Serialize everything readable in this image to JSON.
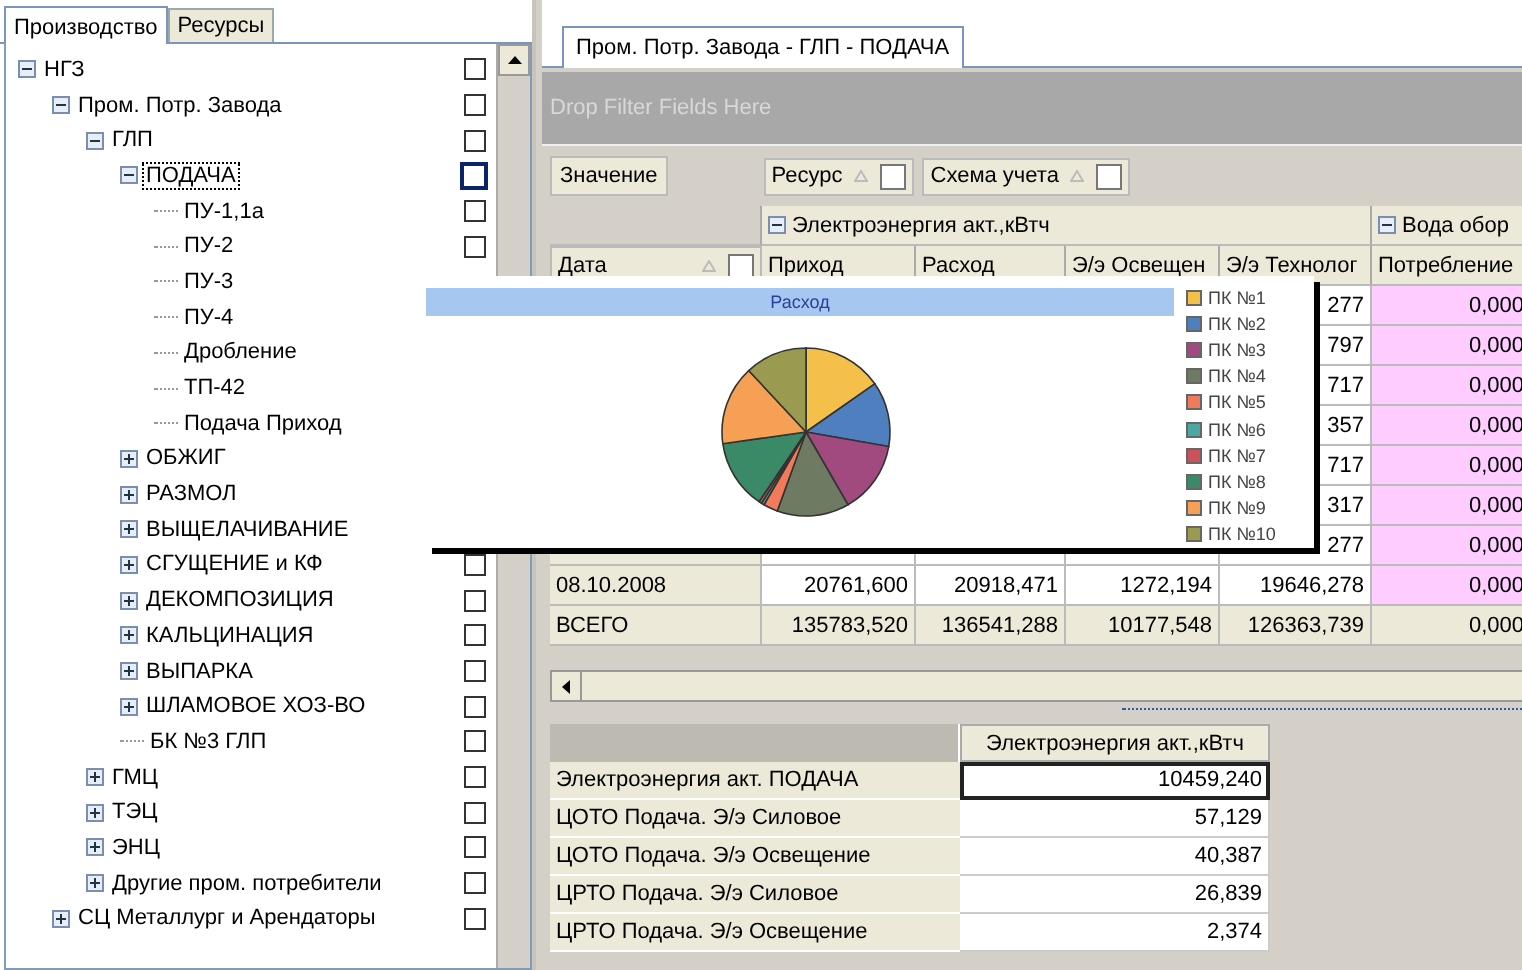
{
  "left_tabs": [
    {
      "label": "Производство",
      "selected": true
    },
    {
      "label": "Ресурсы",
      "selected": false
    }
  ],
  "tree": [
    {
      "label": "НГЗ",
      "expanded": true,
      "checked": false,
      "selected": false,
      "children": [
        {
          "label": "Пром. Потр. Завода",
          "expanded": true,
          "checked": false,
          "selected": false,
          "children": [
            {
              "label": "ГЛП",
              "expanded": true,
              "checked": false,
              "selected": false,
              "children": [
                {
                  "label": "ПОДАЧА",
                  "expanded": true,
                  "checked": false,
                  "selected": true,
                  "children": [
                    {
                      "label": "ПУ-1,1а",
                      "checked": false,
                      "selected": false
                    },
                    {
                      "label": "ПУ-2",
                      "checked": false,
                      "selected": false
                    },
                    {
                      "label": "ПУ-3",
                      "selected": false
                    },
                    {
                      "label": "ПУ-4",
                      "selected": false
                    },
                    {
                      "label": "Дробление",
                      "selected": false
                    },
                    {
                      "label": "ТП-42",
                      "selected": false
                    },
                    {
                      "label": "Подача Приход",
                      "selected": false
                    }
                  ]
                },
                {
                  "label": "ОБЖИГ",
                  "expanded": false,
                  "selected": false
                },
                {
                  "label": "РАЗМОЛ",
                  "expanded": false,
                  "selected": false
                },
                {
                  "label": "ВЫЩЕЛАЧИВАНИЕ",
                  "expanded": false,
                  "selected": false
                },
                {
                  "label": "СГУЩЕНИЕ и КФ",
                  "expanded": false,
                  "checked": false,
                  "selected": false
                },
                {
                  "label": "ДЕКОМПОЗИЦИЯ",
                  "expanded": false,
                  "checked": false,
                  "selected": false
                },
                {
                  "label": "КАЛЬЦИНАЦИЯ",
                  "expanded": false,
                  "checked": false,
                  "selected": false
                },
                {
                  "label": "ВЫПАРКА",
                  "expanded": false,
                  "checked": false,
                  "selected": false
                },
                {
                  "label": "ШЛАМОВОЕ ХОЗ-ВО",
                  "expanded": false,
                  "checked": false,
                  "selected": false
                },
                {
                  "label": "БК №3 ГЛП",
                  "checked": false,
                  "selected": false
                }
              ]
            },
            {
              "label": "ГМЦ",
              "expanded": false,
              "checked": false,
              "selected": false
            },
            {
              "label": "ТЭЦ",
              "expanded": false,
              "checked": false,
              "selected": false
            },
            {
              "label": "ЭНЦ",
              "expanded": false,
              "checked": false,
              "selected": false
            },
            {
              "label": "Другие пром. потребители",
              "expanded": false,
              "checked": false,
              "selected": false
            }
          ]
        },
        {
          "label": "СЦ Металлург и Арендаторы",
          "expanded": false,
          "checked": false,
          "selected": false
        }
      ]
    }
  ],
  "document_tab": {
    "label": "Пром. Потр. Завода - ГЛП - ПОДАЧА",
    "selected": true
  },
  "filter_area": {
    "placeholder": "Drop Filter Fields Here"
  },
  "data_field": "Значение",
  "column_fields": [
    {
      "label": "Ресурс"
    },
    {
      "label": "Схема учета"
    }
  ],
  "row_field": "Дата",
  "column_groups": [
    {
      "label": "Электроэнергия акт.,кВтч",
      "expanded": true,
      "columns": [
        "Приход",
        "Расход",
        "Э/э Освещен",
        "Э/э Технолог"
      ]
    },
    {
      "label": "Вода обор",
      "expanded": true,
      "columns": [
        "Потребление"
      ]
    }
  ],
  "rows": [
    {
      "kind": "partial",
      "cells": [
        "277",
        "0,000"
      ]
    },
    {
      "kind": "partial",
      "cells": [
        "797",
        "0,000"
      ]
    },
    {
      "kind": "partial",
      "cells": [
        "717",
        "0,000"
      ]
    },
    {
      "kind": "partial",
      "cells": [
        "357",
        "0,000"
      ]
    },
    {
      "kind": "partial",
      "cells": [
        "717",
        "0,000"
      ]
    },
    {
      "kind": "partial",
      "cells": [
        "317",
        "0,000"
      ]
    },
    {
      "kind": "partial",
      "cells": [
        "277",
        "0,000"
      ]
    },
    {
      "kind": "data",
      "cells": [
        "08.10.2008",
        "20761,600",
        "20918,471",
        "1272,194",
        "19646,278",
        "0,000"
      ]
    },
    {
      "kind": "total",
      "cells": [
        "ВСЕГО",
        "135783,520",
        "136541,288",
        "10177,548",
        "126363,739",
        "0,000"
      ]
    }
  ],
  "chart_popup": {
    "title": "Расход",
    "legend": [
      {
        "label": "ПК №1",
        "color": "#f5c04a"
      },
      {
        "label": "ПК №2",
        "color": "#4f7fbf"
      },
      {
        "label": "ПК №3",
        "color": "#a04a80"
      },
      {
        "label": "ПК №4",
        "color": "#6e7a62"
      },
      {
        "label": "ПК №5",
        "color": "#f07a5a"
      },
      {
        "label": "ПК №6",
        "color": "#4aa8a0"
      },
      {
        "label": "ПК №7",
        "color": "#d0505a"
      },
      {
        "label": "ПК №8",
        "color": "#3a8a68"
      },
      {
        "label": "ПК №9",
        "color": "#f5a055"
      },
      {
        "label": "ПК №10",
        "color": "#9a9a50"
      }
    ]
  },
  "summary_table": {
    "columns": [
      "Электроэнергия акт.,кВтч"
    ],
    "rows": [
      {
        "label": "Электроэнергия акт. ПОДАЧА",
        "value": "10459,240",
        "selected": true
      },
      {
        "label": "ЦОТО Подача. Э/э Силовое",
        "value": "57,129",
        "selected": false
      },
      {
        "label": "ЦОТО Подача. Э/э Освещение",
        "value": "40,387",
        "selected": false
      },
      {
        "label": "ЦРТО Подача. Э/э Силовое",
        "value": "26,839",
        "selected": false
      },
      {
        "label": "ЦРТО Подача. Э/э Освещение",
        "value": "2,374",
        "selected": false
      }
    ]
  }
}
